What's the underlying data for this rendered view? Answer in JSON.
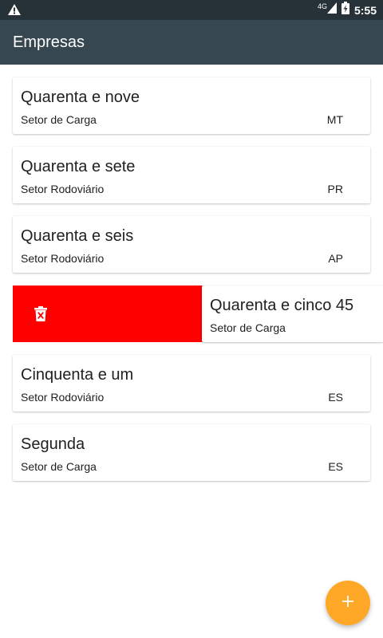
{
  "status_bar": {
    "network": "4G",
    "time": "5:55"
  },
  "app_bar": {
    "title": "Empresas"
  },
  "companies": [
    {
      "name": "Quarenta e nove",
      "sector": "Setor de Carga",
      "uf": "MT"
    },
    {
      "name": "Quarenta e sete",
      "sector": "Setor Rodoviário",
      "uf": "PR"
    },
    {
      "name": "Quarenta e seis",
      "sector": "Setor Rodoviário",
      "uf": "AP"
    },
    {
      "name": "Quarenta e cinco 45",
      "sector": "Setor de Carga",
      "uf": ""
    },
    {
      "name": "Cinquenta e um",
      "sector": "Setor Rodoviário",
      "uf": "ES"
    },
    {
      "name": "Segunda",
      "sector": "Setor de Carga",
      "uf": "ES"
    }
  ],
  "icons": {
    "warning": "warning-icon",
    "signal": "signal-icon",
    "battery": "battery-charging-icon",
    "delete": "trash-icon",
    "add": "add-icon"
  },
  "colors": {
    "status_bar": "#263238",
    "app_bar": "#37474f",
    "delete_background": "#ff0000",
    "fab": "#ffa726"
  }
}
